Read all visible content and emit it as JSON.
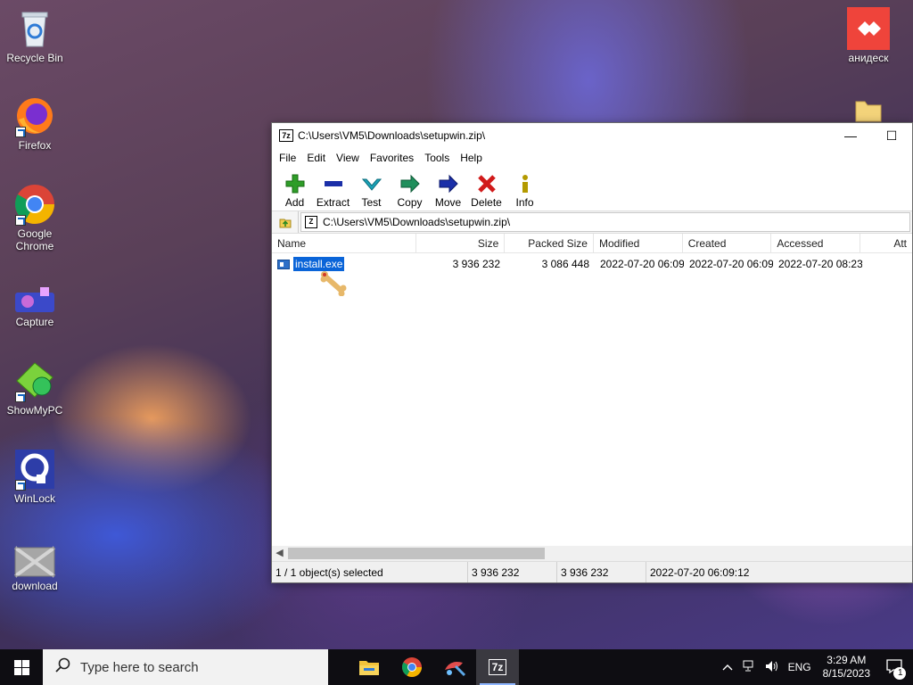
{
  "desktop": {
    "icons": [
      {
        "label": "Recycle Bin"
      },
      {
        "label": "Firefox"
      },
      {
        "label": "Google Chrome"
      },
      {
        "label": "Capture"
      },
      {
        "label": "ShowMyPC"
      },
      {
        "label": "WinLock"
      },
      {
        "label": "download"
      },
      {
        "label": "анидеск"
      }
    ]
  },
  "window": {
    "app_icon": "7z",
    "title": "C:\\Users\\VM5\\Downloads\\setupwin.zip\\",
    "minimize": "—",
    "maximize": "☐",
    "menu": [
      "File",
      "Edit",
      "View",
      "Favorites",
      "Tools",
      "Help"
    ],
    "toolbar": [
      {
        "label": "Add",
        "icon": "plus-icon",
        "color": "#2e9d28"
      },
      {
        "label": "Extract",
        "icon": "minus-icon",
        "color": "#1b2fa8"
      },
      {
        "label": "Test",
        "icon": "check-icon",
        "color": "#1aa3b8"
      },
      {
        "label": "Copy",
        "icon": "copy-arrow-icon",
        "color": "#1f8f5c"
      },
      {
        "label": "Move",
        "icon": "move-arrow-icon",
        "color": "#1b2fa8"
      },
      {
        "label": "Delete",
        "icon": "x-icon",
        "color": "#d11a1a"
      },
      {
        "label": "Info",
        "icon": "info-icon",
        "color": "#b49a00"
      }
    ],
    "address": "C:\\Users\\VM5\\Downloads\\setupwin.zip\\",
    "columns": {
      "name": "Name",
      "size": "Size",
      "packed": "Packed Size",
      "modified": "Modified",
      "created": "Created",
      "accessed": "Accessed",
      "attributes": "Att"
    },
    "rows": [
      {
        "name": "install.exe",
        "size": "3 936 232",
        "packed": "3 086 448",
        "modified": "2022-07-20 06:09",
        "created": "2022-07-20 06:09",
        "accessed": "2022-07-20 08:23"
      }
    ],
    "status": {
      "selection": "1 / 1 object(s) selected",
      "size": "3 936 232",
      "packed": "3 936 232",
      "date": "2022-07-20 06:09:12"
    }
  },
  "taskbar": {
    "search_placeholder": "Type here to search",
    "lang": "ENG",
    "time": "3:29 AM",
    "date": "8/15/2023",
    "notifications": "1"
  },
  "colors": {
    "selection": "#0a64d8",
    "taskbar": "#0e0d12"
  }
}
